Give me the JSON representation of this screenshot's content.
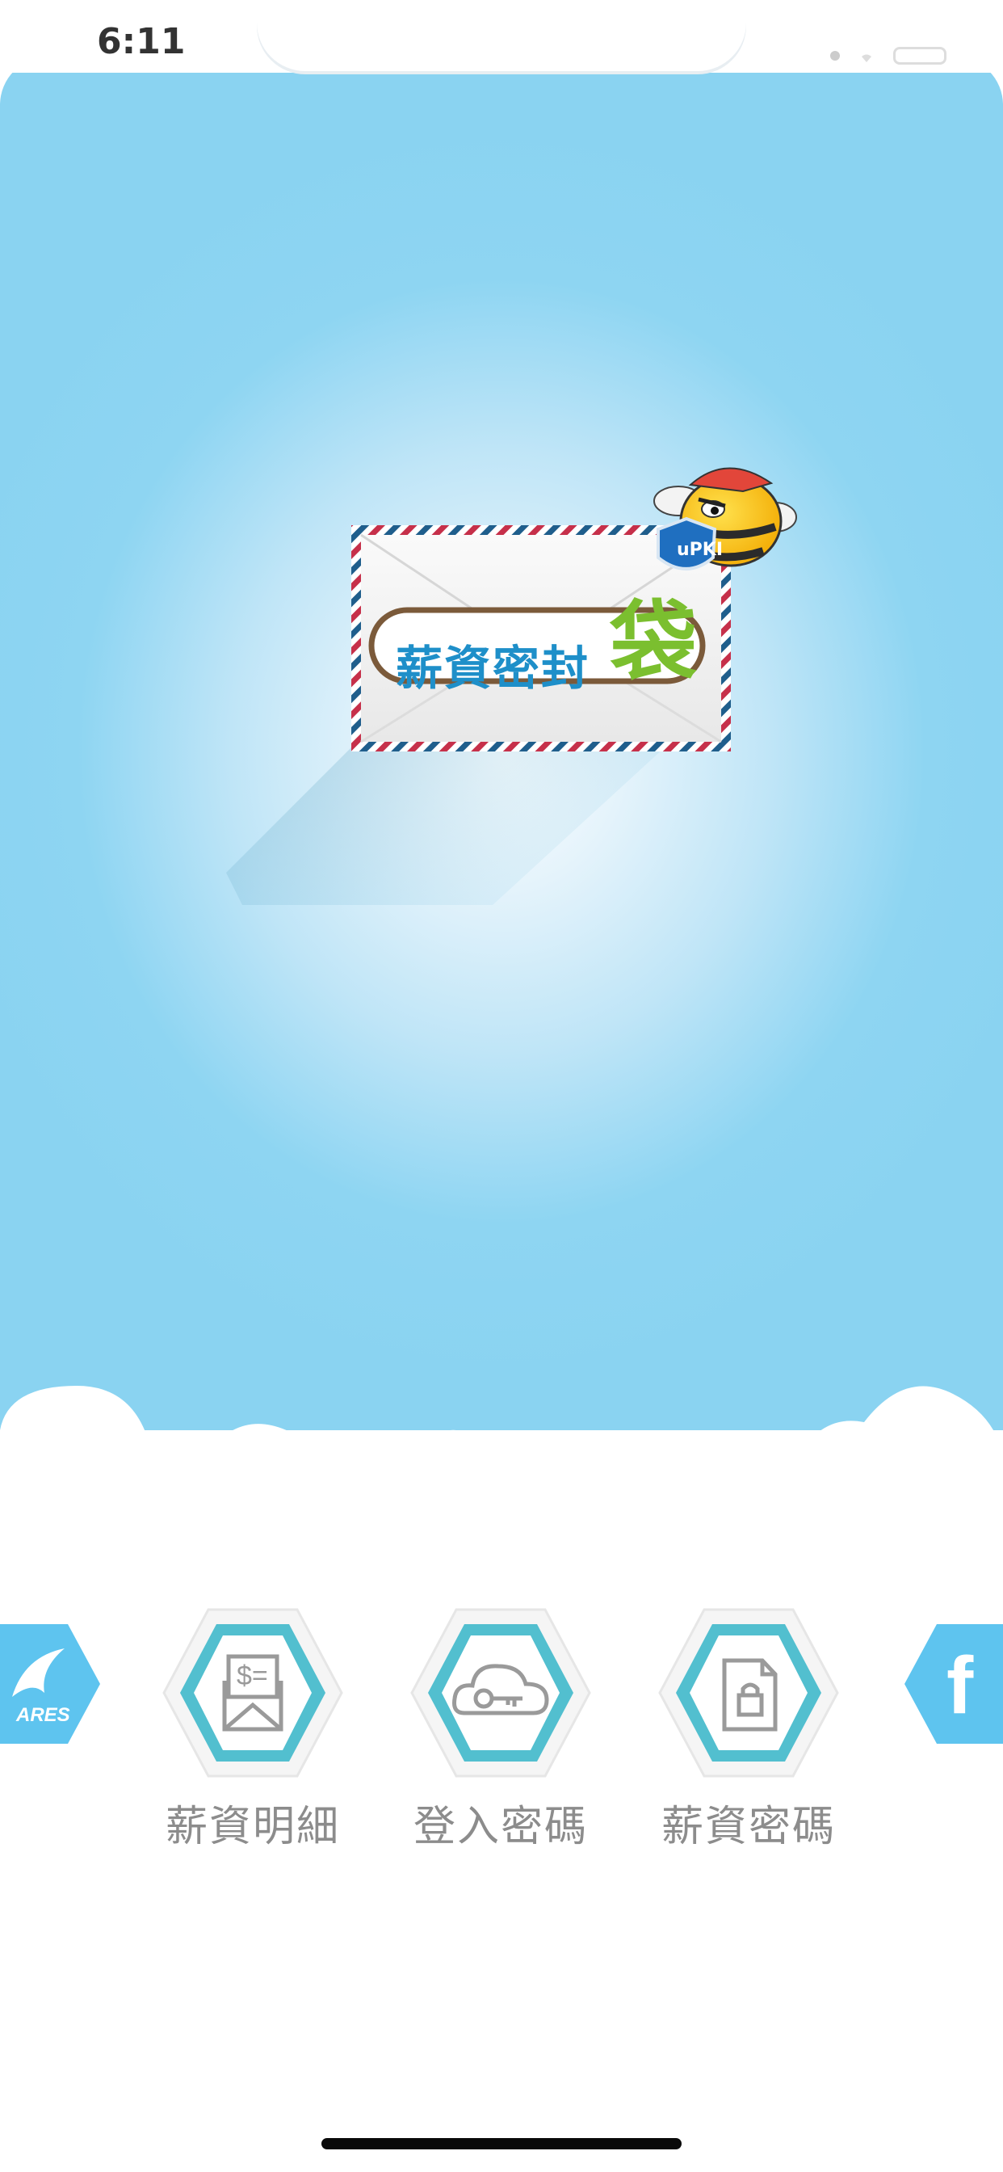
{
  "status_bar": {
    "time": "6:11"
  },
  "logo": {
    "title_main": "薪資密封",
    "title_last": "袋",
    "badge": "uPKI"
  },
  "colors": {
    "sky_edge": "#8ad3f1",
    "sky_center": "#ffffff",
    "hex_teal": "#49b9c9",
    "side_blue": "#5ec4ef",
    "label_gray": "#8c8c8c"
  },
  "nav": {
    "left_badge": {
      "icon": "ares-logo-icon",
      "text": "ARES"
    },
    "items": [
      {
        "label": "薪資明細",
        "icon": "salary-envelope-icon"
      },
      {
        "label": "登入密碼",
        "icon": "cloud-key-icon"
      },
      {
        "label": "薪資密碼",
        "icon": "locked-document-icon"
      }
    ],
    "right_badge": {
      "icon": "facebook-icon",
      "text": "f"
    }
  }
}
